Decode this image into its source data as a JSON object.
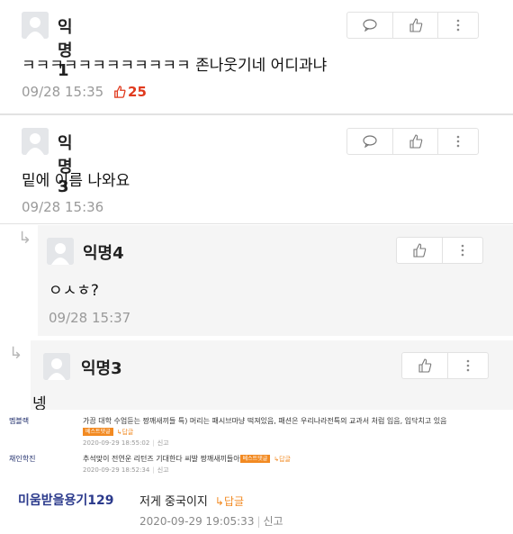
{
  "comments": [
    {
      "user": "익명1",
      "text": "ㅋㅋㅋㅋㅋㅋㅋㅋㅋㅋㅋㅋ 존나웃기네 어디과냐",
      "time": "09/28 15:35",
      "likes": "25"
    },
    {
      "user": "익명3",
      "text": "밑에 이름 나와요",
      "time": "09/28 15:36"
    },
    {
      "user": "익명4",
      "text": "ㅇㅅㅎ?",
      "time": "09/28 15:37"
    },
    {
      "user": "익명3",
      "text": "넹"
    }
  ],
  "embedded": {
    "rows": [
      {
        "name": "멤블랙",
        "line1": "가끔 대학 수업듣는 짱깨새끼들 특) 머리는 패시브마냥 떡져있음, 패션은 우리나라전특의 교과서 처럼 입음, 입닥치고 있음",
        "badge": "베스트댓글",
        "reply": "↳답글",
        "date": "2020-09-29 18:55:02",
        "report": "신고"
      },
      {
        "name": "채인학진",
        "line1": "추석맞이 전연운 리턴즈 기대한다 씨발 짱깨새끼들아",
        "badge": "베스트댓글",
        "reply": "↳답글",
        "date": "2020-09-29 18:52:34",
        "report": "신고"
      }
    ],
    "main": {
      "name": "미움받을용기129",
      "text": "저게 중국이지",
      "reply": "↳답글",
      "date": "2020-09-29 19:05:33",
      "report": "신고"
    }
  },
  "icons": {
    "avatar": "person-silhouette-icon",
    "comment": "speech-bubble-icon",
    "like": "thumbs-up-icon",
    "more": "vertical-dots-icon",
    "reply_arrow": "reply-arrow-icon"
  },
  "colors": {
    "likes": "#e03a1e",
    "badge": "#f28a22",
    "username_blue": "#2b3a8c"
  }
}
